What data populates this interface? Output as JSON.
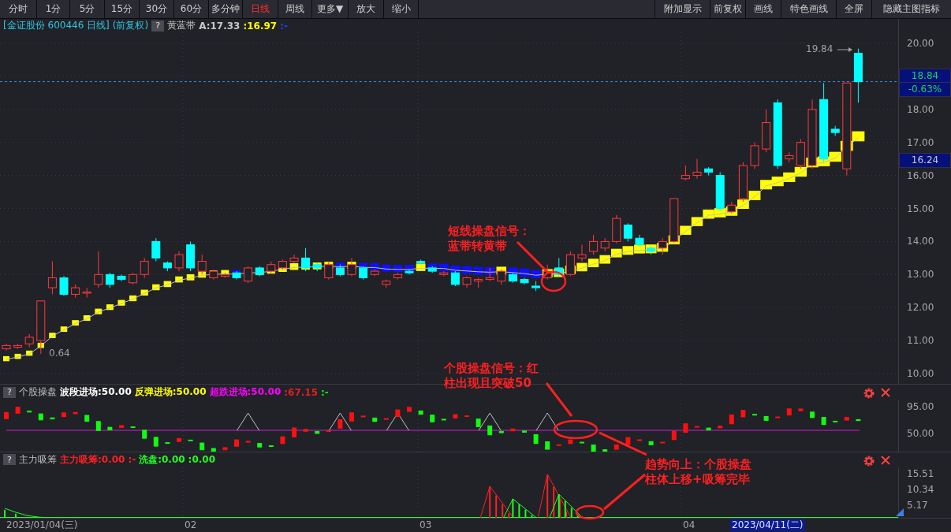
{
  "toolbar": {
    "left": [
      {
        "label": "分时",
        "selected": false
      },
      {
        "label": "1分",
        "selected": false
      },
      {
        "label": "5分",
        "selected": false
      },
      {
        "label": "15分",
        "selected": false
      },
      {
        "label": "30分",
        "selected": false
      },
      {
        "label": "60分",
        "selected": false
      },
      {
        "label": "多分钟",
        "selected": false
      },
      {
        "label": "日线",
        "selected": true
      },
      {
        "label": "周线",
        "selected": false
      },
      {
        "label": "更多▼",
        "selected": false
      },
      {
        "label": "放大",
        "selected": false
      },
      {
        "label": "缩小",
        "selected": false
      }
    ],
    "right": [
      "附加显示",
      "前复权",
      "画线",
      "特色画线",
      "全屏",
      "隐藏主图指标"
    ]
  },
  "header": {
    "title": "[金证股份 600446 日线]",
    "adjust": "(前复权)",
    "help": "?",
    "indicator": "黄蓝带",
    "values": [
      {
        "text": "A:17.33",
        "color": "#c8c8c8"
      },
      {
        "text": ":16.97",
        "color": "#ffff00"
      },
      {
        "text": ":-",
        "color": "#2040ff"
      }
    ]
  },
  "main_chart": {
    "price_axis": [
      "20.00",
      "18.00",
      "17.00",
      "16.00",
      "15.00",
      "14.00",
      "13.00",
      "12.00",
      "11.00",
      "10.00"
    ],
    "price_tags": [
      {
        "text": "18.84",
        "kind": "last"
      },
      {
        "text": "-0.63%",
        "kind": "change"
      },
      {
        "text": "16.24",
        "kind": "cursor"
      }
    ],
    "high_label": "19.84",
    "low_label": "0.64"
  },
  "annotations": [
    {
      "lines": [
        "短线操盘信号：",
        "蓝带转黄带"
      ]
    },
    {
      "lines": [
        "个股操盘信号：红",
        "柱出现且突破50"
      ]
    },
    {
      "lines": [
        "趋势向上：个股操盘",
        "柱体上移+吸筹完毕"
      ]
    }
  ],
  "indicators": [
    {
      "help": "?",
      "name": "个股操盘",
      "values": [
        {
          "text": "波段进场:50.00",
          "color": "#ffffff"
        },
        {
          "text": "反弹进场:50.00",
          "color": "#ffff00"
        },
        {
          "text": "超跌进场:50.00",
          "color": "#ff00ff"
        },
        {
          "text": ":67.15",
          "color": "#e02020"
        },
        {
          "text": ":-",
          "color": "#00ff00"
        }
      ],
      "axis": [
        "95.00",
        "50.00"
      ]
    },
    {
      "help": "?",
      "name": "主力吸筹",
      "values": [
        {
          "text": "主力吸筹:0.00",
          "color": "#ff2020"
        },
        {
          "text": ":-",
          "color": "#ff2020"
        },
        {
          "text": "洗盘:0.00",
          "color": "#20ff20"
        },
        {
          "text": ":0.00",
          "color": "#20ff20"
        }
      ],
      "axis": [
        "15.51",
        "10.34",
        "5.17"
      ]
    }
  ],
  "date_axis": {
    "labels": [
      "2023/01/04(三)",
      "02",
      "03",
      "04"
    ],
    "cursor": "2023/04/11(二)"
  }
}
